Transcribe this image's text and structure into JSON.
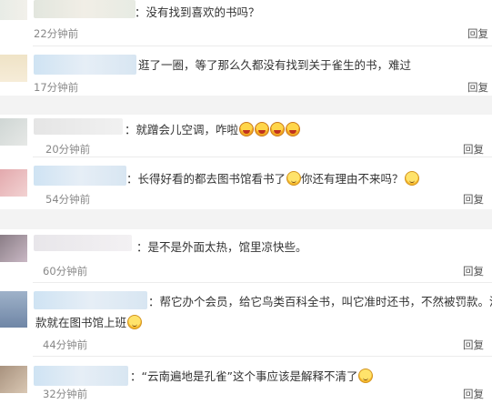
{
  "reply_label": "回复",
  "cards": [
    {
      "comments": [
        {
          "text": "：没有找到喜欢的书吗？",
          "time": "22分钟前"
        },
        {
          "text": "逛了一圈，等了那么久都没有找到关于雀生的书，难过",
          "time": "17分钟前"
        }
      ]
    },
    {
      "comments": [
        {
          "text": "：就蹭会儿空调，咋啦",
          "emojis": [
            "laugh",
            "laugh",
            "laugh",
            "laugh"
          ],
          "time": "20分钟前"
        },
        {
          "text": "：长得好看的都去图书馆看书了",
          "emoji_mid": "smile",
          "text2": "你还有理由不来吗？",
          "emoji_end": "smile",
          "time": "54分钟前"
        }
      ]
    },
    {
      "comments": [
        {
          "text": "：是不是外面太热，馆里凉快些。",
          "time": "60分钟前"
        },
        {
          "text": "：帮它办个会员，给它鸟类百科全书，叫它准时还书，不然被罚款。没",
          "text_line2": "款就在图书馆上班",
          "emojis": [
            "smile"
          ],
          "time": "44分钟前"
        },
        {
          "text": "：“云南遍地是孔雀”这个事应该是解释不清了",
          "emojis": [
            "smile"
          ],
          "time": "32分钟前"
        }
      ]
    }
  ]
}
